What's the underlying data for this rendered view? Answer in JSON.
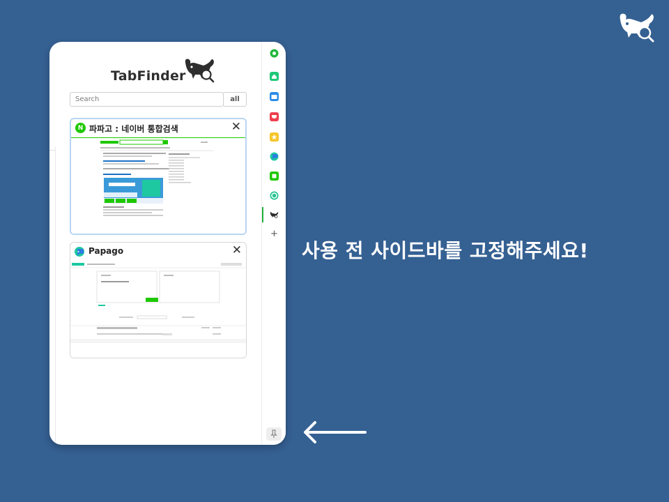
{
  "brand": {
    "name": "TabFinder"
  },
  "search": {
    "placeholder": "Search",
    "value": ""
  },
  "filter": {
    "all_label": "all"
  },
  "tabs": [
    {
      "title": "파파고 : 네이버 통합검색",
      "favicon": "naver-icon",
      "active": true
    },
    {
      "title": "Papago",
      "favicon": "papago-icon",
      "active": false
    }
  ],
  "close_symbol": "✕",
  "rail": {
    "icons": [
      "green-circle-icon",
      "green-home-icon",
      "blue-calendar-icon",
      "red-pocket-icon",
      "yellow-star-icon",
      "papago-icon",
      "green-square-icon",
      "teal-circle-icon",
      "tabfinder-whale-icon"
    ],
    "add_symbol": "+"
  },
  "instruction": "사용 전 사이드바를 고정해주세요!",
  "colors": {
    "background": "#356092",
    "accent": "#1ec800",
    "active_border": "#b9d6f2"
  }
}
